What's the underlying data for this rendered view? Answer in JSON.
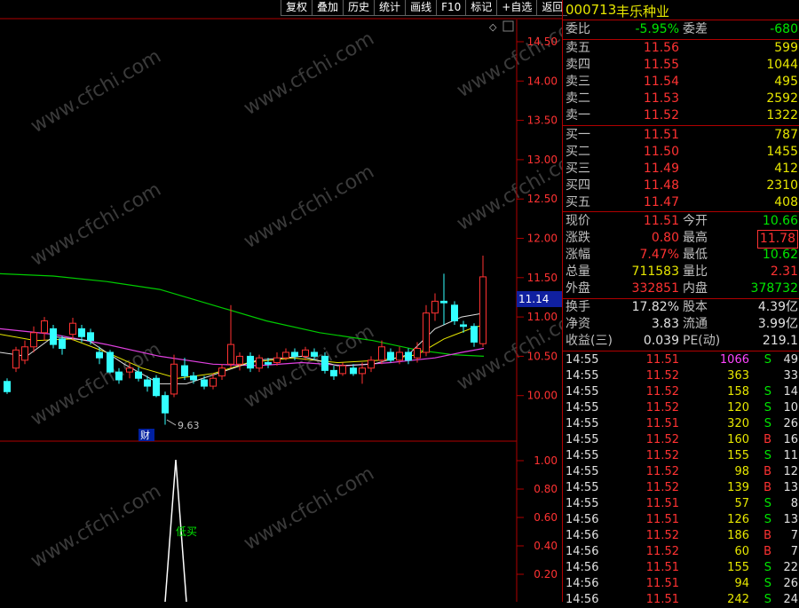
{
  "toolbar": {
    "items": [
      "复权",
      "叠加",
      "历史",
      "统计",
      "画线",
      "F10",
      "标记",
      "+自选",
      "返回"
    ]
  },
  "chart": {
    "price_axis": [
      "14.50",
      "14.00",
      "13.50",
      "13.00",
      "12.50",
      "12.00",
      "11.50",
      "11.00",
      "10.50",
      "10.00"
    ],
    "current_price_tag": "11.14",
    "low_label": "9.63",
    "event_marker": "财",
    "indicator_axis": [
      "1.00",
      "0.80",
      "0.60",
      "0.40",
      "0.20"
    ],
    "signal_label": "低买",
    "diamond": "◇",
    "watermark": "www.cfchi.com"
  },
  "quote": {
    "code": "000713",
    "name": "丰乐种业",
    "weibi": {
      "label": "委比",
      "value": "-5.95%",
      "label2": "委差",
      "value2": "-680"
    },
    "sell": [
      {
        "label": "卖五",
        "price": "11.56",
        "vol": "599"
      },
      {
        "label": "卖四",
        "price": "11.55",
        "vol": "1044"
      },
      {
        "label": "卖三",
        "price": "11.54",
        "vol": "495"
      },
      {
        "label": "卖二",
        "price": "11.53",
        "vol": "2592"
      },
      {
        "label": "卖一",
        "price": "11.52",
        "vol": "1322"
      }
    ],
    "buy": [
      {
        "label": "买一",
        "price": "11.51",
        "vol": "787"
      },
      {
        "label": "买二",
        "price": "11.50",
        "vol": "1455"
      },
      {
        "label": "买三",
        "price": "11.49",
        "vol": "412"
      },
      {
        "label": "买四",
        "price": "11.48",
        "vol": "2310"
      },
      {
        "label": "买五",
        "price": "11.47",
        "vol": "408"
      }
    ],
    "stats": [
      {
        "l1": "现价",
        "v1": "11.51",
        "l2": "今开",
        "v2": "10.66"
      },
      {
        "l1": "涨跌",
        "v1": "0.80",
        "l2": "最高",
        "v2": "11.78"
      },
      {
        "l1": "涨幅",
        "v1": "7.47%",
        "l2": "最低",
        "v2": "10.62"
      },
      {
        "l1": "总量",
        "v1": "711583",
        "l2": "量比",
        "v2": "2.31"
      },
      {
        "l1": "外盘",
        "v1": "332851",
        "l2": "内盘",
        "v2": "378732"
      }
    ],
    "fundamentals": [
      {
        "l1": "换手",
        "v1": "17.82%",
        "l2": "股本",
        "v2": "4.39亿"
      },
      {
        "l1": "净资",
        "v1": "3.83",
        "l2": "流通",
        "v2": "3.99亿"
      },
      {
        "l1": "收益(三)",
        "v1": "0.039",
        "l2": "PE(动)",
        "v2": "219.1"
      }
    ],
    "ticks": [
      {
        "time": "14:55",
        "price": "11.51",
        "vol": "1066",
        "side": "S",
        "n": "49"
      },
      {
        "time": "14:55",
        "price": "11.52",
        "vol": "363",
        "side": "",
        "n": "33"
      },
      {
        "time": "14:55",
        "price": "11.52",
        "vol": "158",
        "side": "S",
        "n": "14"
      },
      {
        "time": "14:55",
        "price": "11.52",
        "vol": "120",
        "side": "S",
        "n": "10"
      },
      {
        "time": "14:55",
        "price": "11.51",
        "vol": "320",
        "side": "S",
        "n": "26"
      },
      {
        "time": "14:55",
        "price": "11.52",
        "vol": "160",
        "side": "B",
        "n": "16"
      },
      {
        "time": "14:55",
        "price": "11.52",
        "vol": "155",
        "side": "S",
        "n": "11"
      },
      {
        "time": "14:55",
        "price": "11.52",
        "vol": "98",
        "side": "B",
        "n": "12"
      },
      {
        "time": "14:55",
        "price": "11.52",
        "vol": "139",
        "side": "B",
        "n": "13"
      },
      {
        "time": "14:55",
        "price": "11.51",
        "vol": "57",
        "side": "S",
        "n": "8"
      },
      {
        "time": "14:56",
        "price": "11.51",
        "vol": "126",
        "side": "S",
        "n": "13"
      },
      {
        "time": "14:56",
        "price": "11.52",
        "vol": "186",
        "side": "B",
        "n": "7"
      },
      {
        "time": "14:56",
        "price": "11.52",
        "vol": "60",
        "side": "B",
        "n": "7"
      },
      {
        "time": "14:56",
        "price": "11.51",
        "vol": "155",
        "side": "S",
        "n": "22"
      },
      {
        "time": "14:56",
        "price": "11.51",
        "vol": "94",
        "side": "S",
        "n": "26"
      },
      {
        "time": "14:56",
        "price": "11.51",
        "vol": "242",
        "side": "S",
        "n": "24"
      }
    ]
  }
}
